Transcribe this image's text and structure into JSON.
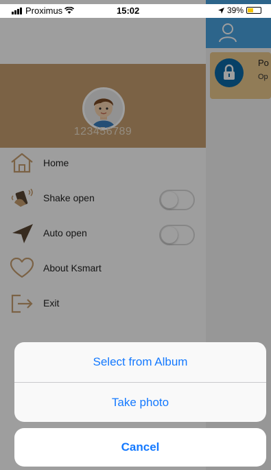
{
  "status_bar": {
    "carrier": "Proximus",
    "time": "15:02",
    "battery_percent": "39%"
  },
  "drawer": {
    "account_number": "123456789",
    "menu": [
      {
        "label": "Home",
        "icon": "home-icon"
      },
      {
        "label": "Shake open",
        "icon": "shake-phone-icon",
        "toggle_on": false
      },
      {
        "label": "Auto open",
        "icon": "location-arrow-icon",
        "toggle_on": false
      },
      {
        "label": "About Ksmart",
        "icon": "heart-icon"
      },
      {
        "label": "Exit",
        "icon": "exit-icon"
      }
    ]
  },
  "background_app": {
    "card_title": "Po",
    "card_subtitle": "Op"
  },
  "action_sheet": {
    "options": [
      "Select from Album",
      "Take photo"
    ],
    "cancel": "Cancel"
  },
  "colors": {
    "header_tan": "#c79f70",
    "app_blue": "#4aa3e0",
    "ios_blue": "#1479ff",
    "card_circle": "#0c6aa7"
  }
}
